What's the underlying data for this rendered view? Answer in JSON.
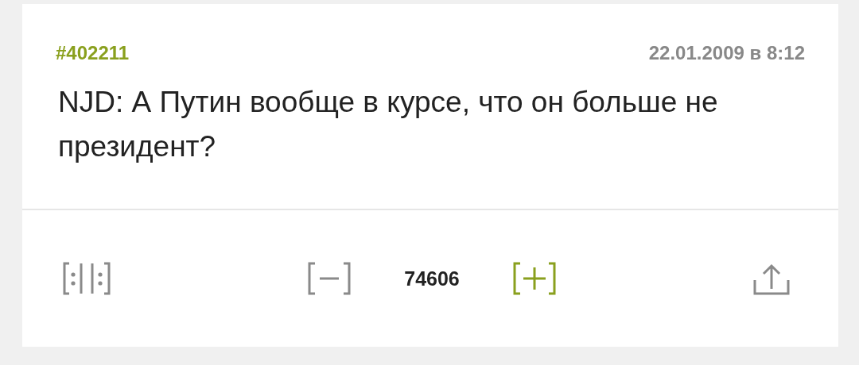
{
  "quote": {
    "number": "#402211",
    "date": "22.01.2009 в 8:12",
    "text": "NJD: А Путин вообще в курсе, что он больше не президент?"
  },
  "actions": {
    "rating": "74606"
  }
}
